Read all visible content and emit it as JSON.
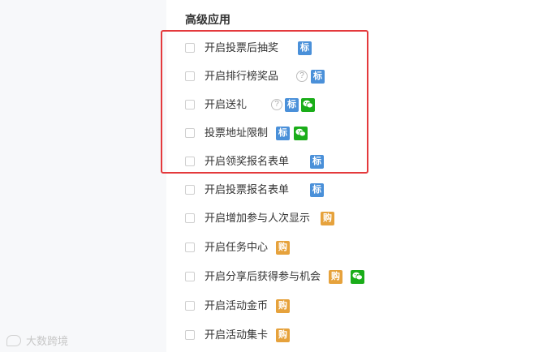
{
  "section_title": "高级应用",
  "colors": {
    "tag_blue": "#4a90d9",
    "tag_orange": "#e6a23c",
    "wechat_green": "#1aad19",
    "highlight_red": "#e4393c"
  },
  "badges": {
    "tag": "标",
    "buy": "购",
    "help": "?"
  },
  "options": [
    {
      "label": "开启投票后抽奖"
    },
    {
      "label": "开启排行榜奖品"
    },
    {
      "label": "开启送礼"
    },
    {
      "label": "投票地址限制"
    },
    {
      "label": "开启领奖报名表单"
    },
    {
      "label": "开启投票报名表单"
    },
    {
      "label": "开启增加参与人次显示"
    },
    {
      "label": "开启任务中心"
    },
    {
      "label": "开启分享后获得参与机会"
    },
    {
      "label": "开启活动金币"
    },
    {
      "label": "开启活动集卡"
    }
  ],
  "watermark": "大数跨境"
}
